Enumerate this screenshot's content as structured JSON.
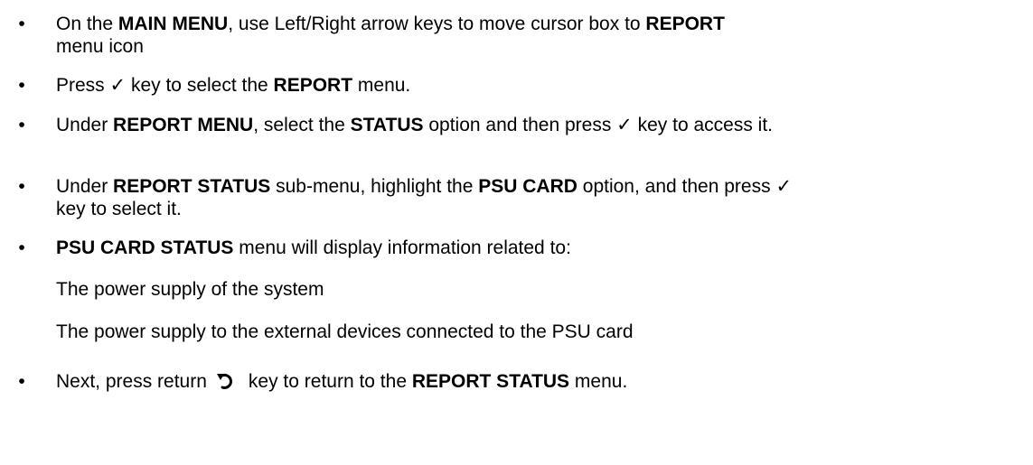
{
  "bullet_glyph": "•",
  "check_glyph": "✓",
  "b1": {
    "t1": "On the ",
    "s1": "MAIN MENU",
    "t2": ", use Left/Right arrow keys to move cursor box to ",
    "s2": "REPORT",
    "t3": " menu icon"
  },
  "b2": {
    "t1": "Press ",
    "t2": " key to select the ",
    "s1": "REPORT",
    "t3": " menu."
  },
  "b3": {
    "t1": "Under ",
    "s1": "REPORT MENU",
    "t2": ", select the ",
    "s2": "STATUS",
    "t3": " option and then press ",
    "t4": " key to access it."
  },
  "b4": {
    "t1": "Under ",
    "s1": "REPORT STATUS",
    "t2": " sub-menu, highlight the ",
    "s2": "PSU CARD",
    "t3": " option, and then press ",
    "t4": " key to select it."
  },
  "b5": {
    "s1": "PSU CARD STATUS",
    "t1": " menu will display information related to:",
    "sub1": "The power supply of the system",
    "sub2": "The power supply to the external devices connected to the PSU card"
  },
  "b6": {
    "t1": "Next, press return",
    "icon": "return-icon",
    "t2": "key to return to the ",
    "s1": "REPORT STATUS",
    "t3": " menu."
  }
}
